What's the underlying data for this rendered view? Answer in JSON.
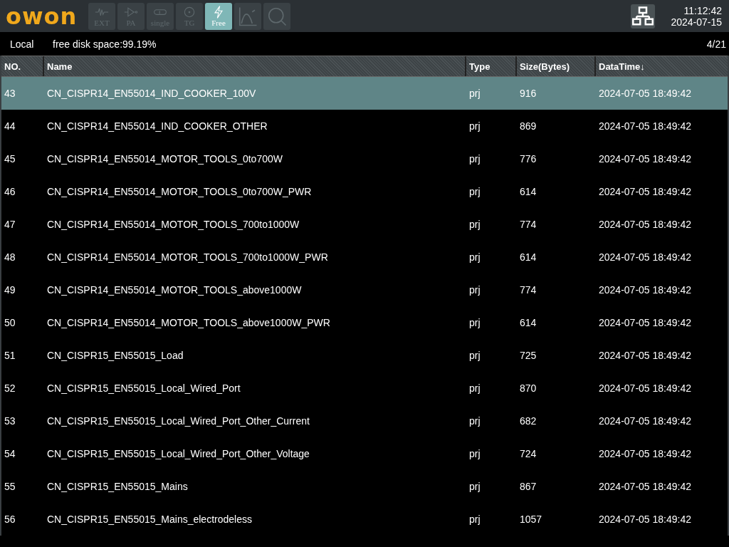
{
  "logo": "owon",
  "toolbar": [
    {
      "kind": "wave",
      "label": "EXT",
      "selected": false,
      "disabled": true
    },
    {
      "kind": "amplifier",
      "label": "PA",
      "selected": false,
      "disabled": true
    },
    {
      "kind": "loop",
      "label": "single",
      "selected": false,
      "disabled": true
    },
    {
      "kind": "circle",
      "label": "TG",
      "selected": false,
      "disabled": true
    },
    {
      "kind": "bolt",
      "label": "Free",
      "selected": true,
      "disabled": false
    },
    {
      "kind": "chart",
      "selected": false,
      "disabled": true
    },
    {
      "kind": "search",
      "selected": false,
      "disabled": true
    }
  ],
  "clock": {
    "time": "11:12:42",
    "date": "2024-07-15"
  },
  "info_bar": {
    "location": "Local",
    "disk": "free disk space:99.19%",
    "page": "4/21"
  },
  "table": {
    "columns": [
      "NO.",
      "Name",
      "Type",
      "Size(Bytes)",
      "DataTime↓"
    ],
    "rows": [
      {
        "cells": [
          "43",
          "CN_CISPR14_EN55014_IND_COOKER_100V",
          "prj",
          "916",
          "2024-07-05 18:49:42"
        ],
        "selected": true
      },
      {
        "cells": [
          "44",
          "CN_CISPR14_EN55014_IND_COOKER_OTHER",
          "prj",
          "869",
          "2024-07-05 18:49:42"
        ],
        "selected": false
      },
      {
        "cells": [
          "45",
          "CN_CISPR14_EN55014_MOTOR_TOOLS_0to700W",
          "prj",
          "776",
          "2024-07-05 18:49:42"
        ],
        "selected": false
      },
      {
        "cells": [
          "46",
          "CN_CISPR14_EN55014_MOTOR_TOOLS_0to700W_PWR",
          "prj",
          "614",
          "2024-07-05 18:49:42"
        ],
        "selected": false
      },
      {
        "cells": [
          "47",
          "CN_CISPR14_EN55014_MOTOR_TOOLS_700to1000W",
          "prj",
          "774",
          "2024-07-05 18:49:42"
        ],
        "selected": false
      },
      {
        "cells": [
          "48",
          "CN_CISPR14_EN55014_MOTOR_TOOLS_700to1000W_PWR",
          "prj",
          "614",
          "2024-07-05 18:49:42"
        ],
        "selected": false
      },
      {
        "cells": [
          "49",
          "CN_CISPR14_EN55014_MOTOR_TOOLS_above1000W",
          "prj",
          "774",
          "2024-07-05 18:49:42"
        ],
        "selected": false
      },
      {
        "cells": [
          "50",
          "CN_CISPR14_EN55014_MOTOR_TOOLS_above1000W_PWR",
          "prj",
          "614",
          "2024-07-05 18:49:42"
        ],
        "selected": false
      },
      {
        "cells": [
          "51",
          "CN_CISPR15_EN55015_Load",
          "prj",
          "725",
          "2024-07-05 18:49:42"
        ],
        "selected": false
      },
      {
        "cells": [
          "52",
          "CN_CISPR15_EN55015_Local_Wired_Port",
          "prj",
          "870",
          "2024-07-05 18:49:42"
        ],
        "selected": false
      },
      {
        "cells": [
          "53",
          "CN_CISPR15_EN55015_Local_Wired_Port_Other_Current",
          "prj",
          "682",
          "2024-07-05 18:49:42"
        ],
        "selected": false
      },
      {
        "cells": [
          "54",
          "CN_CISPR15_EN55015_Local_Wired_Port_Other_Voltage",
          "prj",
          "724",
          "2024-07-05 18:49:42"
        ],
        "selected": false
      },
      {
        "cells": [
          "55",
          "CN_CISPR15_EN55015_Mains",
          "prj",
          "867",
          "2024-07-05 18:49:42"
        ],
        "selected": false
      },
      {
        "cells": [
          "56",
          "CN_CISPR15_EN55015_Mains_electrodeless",
          "prj",
          "1057",
          "2024-07-05 18:49:42"
        ],
        "selected": false
      }
    ]
  }
}
